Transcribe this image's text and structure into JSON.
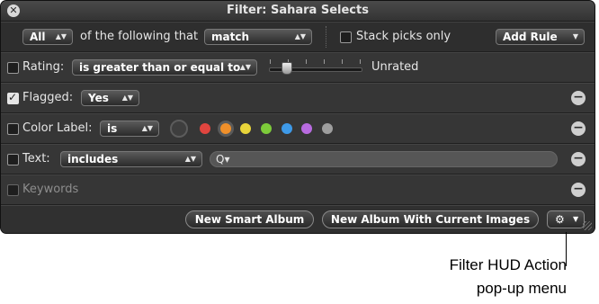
{
  "window": {
    "title": "Filter: Sahara Selects"
  },
  "header": {
    "match_scope": "All",
    "of_text": "of the following that",
    "match_mode": "match",
    "stack_picks_label": "Stack picks only",
    "stack_picks_checked": false,
    "add_rule_label": "Add Rule"
  },
  "rules": {
    "rating": {
      "label": "Rating:",
      "enabled": false,
      "operator": "is greater than or equal to",
      "value_text": "Unrated",
      "slider_level": 0
    },
    "flagged": {
      "label": "Flagged:",
      "enabled": true,
      "value": "Yes"
    },
    "color_label": {
      "label": "Color Label:",
      "enabled": false,
      "operator": "is",
      "swatches": [
        {
          "name": "red",
          "color": "#e0453f"
        },
        {
          "name": "orange",
          "color": "#f0902a",
          "selected": true
        },
        {
          "name": "yellow",
          "color": "#e8d43a"
        },
        {
          "name": "green",
          "color": "#7dcb3a"
        },
        {
          "name": "blue",
          "color": "#3e9ae8"
        },
        {
          "name": "purple",
          "color": "#b86be0"
        },
        {
          "name": "gray",
          "color": "#9e9e9e"
        }
      ]
    },
    "text": {
      "label": "Text:",
      "enabled": false,
      "operator": "includes",
      "search_icon": "Q▾",
      "value": ""
    },
    "keywords": {
      "label": "Keywords",
      "enabled": false
    }
  },
  "footer": {
    "new_smart_album_label": "New Smart Album",
    "new_album_label": "New Album With Current Images",
    "action_icon": "gear-icon"
  },
  "callout": {
    "line1": "Filter HUD Action",
    "line2": "pop-up menu"
  }
}
